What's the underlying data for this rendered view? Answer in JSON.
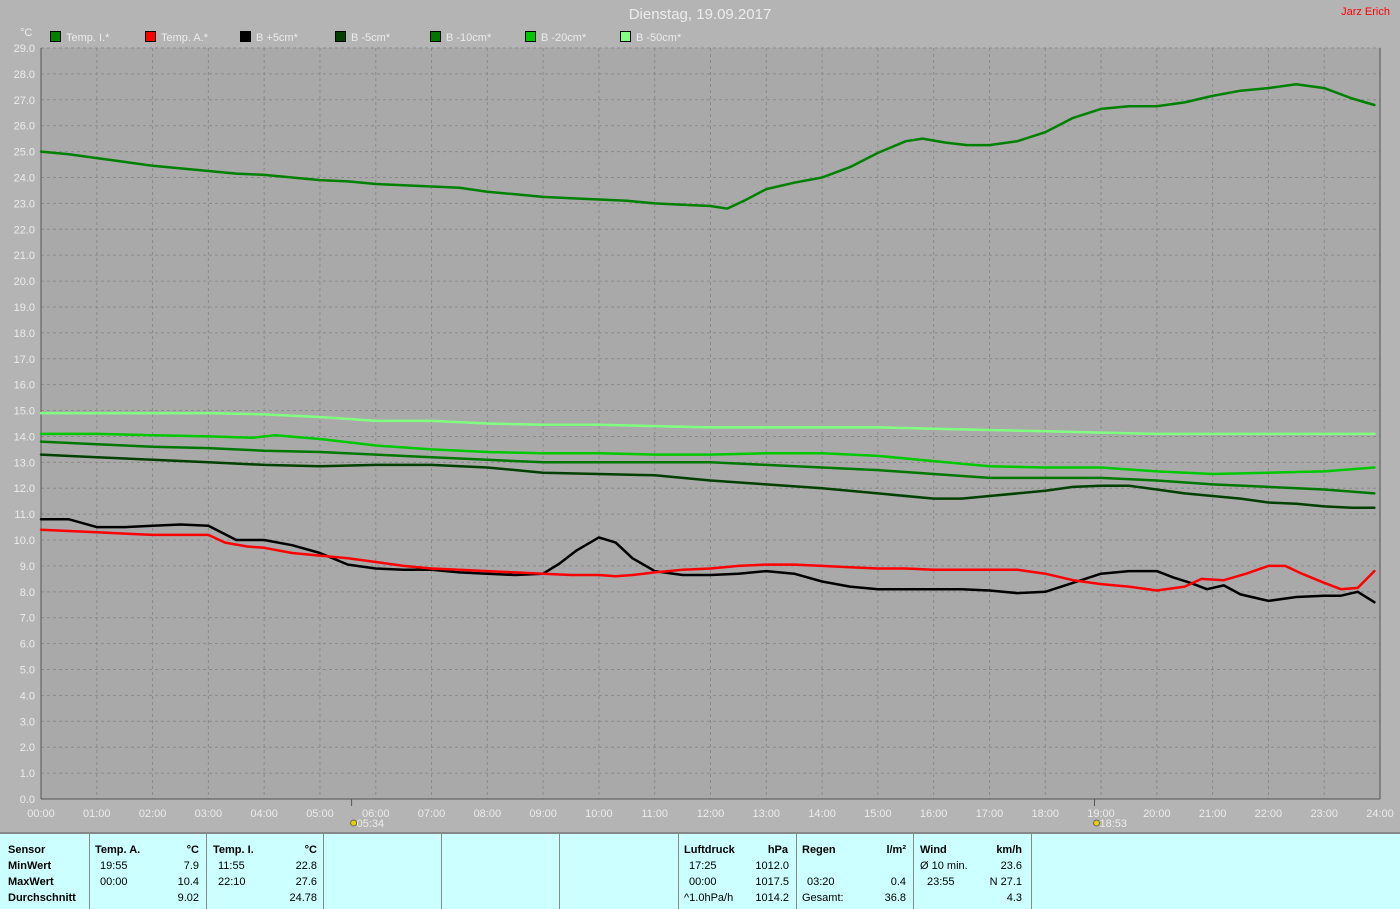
{
  "header": {
    "title": "Dienstag, 19.09.2017",
    "author": "Jarz Erich",
    "unit": "°C"
  },
  "legend": [
    {
      "label": "Temp. I.*",
      "color": "#008000"
    },
    {
      "label": "Temp. A.*",
      "color": "#ff0000"
    },
    {
      "label": "B +5cm*",
      "color": "#000000"
    },
    {
      "label": "B -5cm*",
      "color": "#004000"
    },
    {
      "label": "B -10cm*",
      "color": "#007800"
    },
    {
      "label": "B -20cm*",
      "color": "#00c800"
    },
    {
      "label": "B -50cm*",
      "color": "#80ff80"
    }
  ],
  "sun": {
    "sunrise": "05:34",
    "sunset": "18:53",
    "sunrise_hour": 5.567,
    "sunset_hour": 18.883
  },
  "chart_data": {
    "type": "line",
    "title": "Dienstag, 19.09.2017",
    "ylabel": "°C",
    "ylim": [
      0,
      29
    ],
    "xlim": [
      0,
      24
    ],
    "grid": true,
    "legend_position": "top",
    "y_ticks": [
      "0.0",
      "1.0",
      "2.0",
      "3.0",
      "4.0",
      "5.0",
      "6.0",
      "7.0",
      "8.0",
      "9.0",
      "10.0",
      "11.0",
      "12.0",
      "13.0",
      "14.0",
      "15.0",
      "16.0",
      "17.0",
      "18.0",
      "19.0",
      "20.0",
      "21.0",
      "22.0",
      "23.0",
      "24.0",
      "25.0",
      "26.0",
      "27.0",
      "28.0",
      "29.0"
    ],
    "x_ticks": [
      "00:00",
      "01:00",
      "02:00",
      "03:00",
      "04:00",
      "05:00",
      "06:00",
      "07:00",
      "08:00",
      "09:00",
      "10:00",
      "11:00",
      "12:00",
      "13:00",
      "14:00",
      "15:00",
      "16:00",
      "17:00",
      "18:00",
      "19:00",
      "20:00",
      "21:00",
      "22:00",
      "23:00",
      "24:00"
    ],
    "series": [
      {
        "name": "Temp. I.*",
        "color": "#008000",
        "x": [
          0,
          0.5,
          1,
          1.5,
          2,
          2.5,
          3,
          3.5,
          4,
          4.5,
          5,
          5.5,
          6,
          6.5,
          7,
          7.5,
          8,
          8.5,
          9,
          9.5,
          10,
          10.5,
          11,
          11.5,
          12,
          12.3,
          12.6,
          13,
          13.5,
          14,
          14.5,
          15,
          15.5,
          15.8,
          16.2,
          16.6,
          17,
          17.5,
          18,
          18.5,
          19,
          19.5,
          20,
          20.5,
          21,
          21.5,
          22,
          22.5,
          23,
          23.5,
          23.9
        ],
        "y": [
          25.0,
          24.9,
          24.75,
          24.6,
          24.45,
          24.35,
          24.25,
          24.15,
          24.1,
          24.0,
          23.9,
          23.85,
          23.75,
          23.7,
          23.65,
          23.6,
          23.45,
          23.35,
          23.25,
          23.2,
          23.15,
          23.1,
          23.0,
          22.95,
          22.9,
          22.8,
          23.1,
          23.55,
          23.8,
          24.0,
          24.4,
          24.95,
          25.4,
          25.5,
          25.35,
          25.25,
          25.25,
          25.4,
          25.75,
          26.3,
          26.65,
          26.75,
          26.75,
          26.9,
          27.15,
          27.35,
          27.45,
          27.6,
          27.45,
          27.05,
          26.8
        ]
      },
      {
        "name": "Temp. A.*",
        "color": "#ff0000",
        "x": [
          0,
          0.5,
          1,
          1.5,
          2,
          2.5,
          3,
          3.3,
          3.7,
          4,
          4.5,
          5,
          5.5,
          6,
          6.5,
          7,
          7.5,
          8,
          8.5,
          9,
          9.5,
          10,
          10.3,
          10.6,
          11,
          11.5,
          12,
          12.5,
          13,
          13.5,
          14,
          14.5,
          15,
          15.5,
          16,
          16.5,
          17,
          17.5,
          18,
          18.5,
          19,
          19.5,
          20,
          20.5,
          20.8,
          21.2,
          21.6,
          22,
          22.3,
          22.6,
          23,
          23.3,
          23.6,
          23.9
        ],
        "y": [
          10.4,
          10.35,
          10.3,
          10.25,
          10.2,
          10.2,
          10.2,
          9.9,
          9.75,
          9.7,
          9.5,
          9.4,
          9.3,
          9.15,
          9.0,
          8.9,
          8.85,
          8.8,
          8.75,
          8.7,
          8.65,
          8.65,
          8.6,
          8.65,
          8.75,
          8.85,
          8.9,
          9.0,
          9.05,
          9.05,
          9.0,
          8.95,
          8.9,
          8.9,
          8.85,
          8.85,
          8.85,
          8.85,
          8.7,
          8.45,
          8.3,
          8.2,
          8.05,
          8.2,
          8.5,
          8.45,
          8.7,
          9.0,
          9.0,
          8.7,
          8.35,
          8.1,
          8.15,
          8.8
        ]
      },
      {
        "name": "B +5cm*",
        "color": "#000000",
        "x": [
          0,
          0.5,
          1,
          1.5,
          2,
          2.5,
          3,
          3.5,
          4,
          4.5,
          5,
          5.5,
          6,
          6.5,
          7,
          7.5,
          8,
          8.5,
          9,
          9.3,
          9.6,
          10,
          10.3,
          10.6,
          11,
          11.5,
          12,
          12.5,
          13,
          13.5,
          14,
          14.5,
          15,
          15.5,
          16,
          16.5,
          17,
          17.5,
          18,
          18.5,
          19,
          19.5,
          20,
          20.3,
          20.6,
          20.9,
          21.2,
          21.5,
          22,
          22.5,
          23,
          23.3,
          23.6,
          23.9
        ],
        "y": [
          10.8,
          10.8,
          10.5,
          10.5,
          10.55,
          10.6,
          10.55,
          10.0,
          10.0,
          9.8,
          9.5,
          9.05,
          8.9,
          8.85,
          8.85,
          8.75,
          8.7,
          8.65,
          8.7,
          9.1,
          9.6,
          10.1,
          9.9,
          9.3,
          8.8,
          8.65,
          8.65,
          8.7,
          8.8,
          8.7,
          8.4,
          8.2,
          8.1,
          8.1,
          8.1,
          8.1,
          8.05,
          7.95,
          8.0,
          8.35,
          8.7,
          8.8,
          8.8,
          8.55,
          8.35,
          8.1,
          8.25,
          7.9,
          7.65,
          7.8,
          7.85,
          7.85,
          8.0,
          7.6
        ]
      },
      {
        "name": "B -5cm*",
        "color": "#004000",
        "x": [
          0,
          1,
          2,
          3,
          4,
          5,
          6,
          7,
          8,
          9,
          10,
          11,
          12,
          13,
          14,
          15,
          16,
          16.5,
          17,
          17.5,
          18,
          18.5,
          19,
          19.5,
          20,
          20.5,
          21,
          21.5,
          22,
          22.5,
          23,
          23.5,
          23.9
        ],
        "y": [
          13.3,
          13.2,
          13.1,
          13.0,
          12.9,
          12.85,
          12.9,
          12.9,
          12.8,
          12.6,
          12.55,
          12.5,
          12.3,
          12.15,
          12.0,
          11.8,
          11.6,
          11.6,
          11.7,
          11.8,
          11.9,
          12.05,
          12.1,
          12.1,
          11.95,
          11.8,
          11.7,
          11.6,
          11.45,
          11.4,
          11.3,
          11.25,
          11.25
        ]
      },
      {
        "name": "B -10cm*",
        "color": "#007800",
        "x": [
          0,
          1,
          2,
          3,
          4,
          5,
          6,
          7,
          8,
          9,
          10,
          11,
          12,
          13,
          14,
          15,
          16,
          17,
          18,
          19,
          20,
          21,
          22,
          23,
          23.9
        ],
        "y": [
          13.8,
          13.7,
          13.6,
          13.55,
          13.45,
          13.4,
          13.3,
          13.2,
          13.1,
          13.0,
          13.0,
          13.0,
          13.0,
          12.9,
          12.8,
          12.7,
          12.55,
          12.4,
          12.4,
          12.4,
          12.3,
          12.15,
          12.05,
          11.95,
          11.8
        ]
      },
      {
        "name": "B -20cm*",
        "color": "#00c800",
        "x": [
          0,
          1,
          2,
          3,
          3.8,
          4.2,
          5,
          6,
          7,
          8,
          9,
          10,
          11,
          12,
          13,
          14,
          15,
          16,
          17,
          18,
          19,
          20,
          21,
          22,
          23,
          23.9
        ],
        "y": [
          14.1,
          14.1,
          14.05,
          14.0,
          13.95,
          14.05,
          13.9,
          13.65,
          13.5,
          13.4,
          13.35,
          13.35,
          13.3,
          13.3,
          13.35,
          13.35,
          13.25,
          13.05,
          12.85,
          12.8,
          12.8,
          12.65,
          12.55,
          12.6,
          12.65,
          12.8
        ]
      },
      {
        "name": "B -50cm*",
        "color": "#80ff80",
        "x": [
          0,
          1,
          2,
          3,
          4,
          5,
          6,
          7,
          8,
          9,
          10,
          11,
          12,
          13,
          14,
          15,
          16,
          17,
          18,
          19,
          20,
          21,
          22,
          23,
          23.9
        ],
        "y": [
          14.9,
          14.9,
          14.9,
          14.9,
          14.85,
          14.75,
          14.6,
          14.6,
          14.5,
          14.45,
          14.45,
          14.4,
          14.35,
          14.35,
          14.35,
          14.35,
          14.3,
          14.25,
          14.2,
          14.15,
          14.1,
          14.1,
          14.1,
          14.1,
          14.1
        ]
      }
    ]
  },
  "table": {
    "sensor": {
      "header": "Sensor",
      "min": "MinWert",
      "max": "MaxWert",
      "avg": "Durchschnitt"
    },
    "temp_a": {
      "header": "Temp. A.",
      "unit": "°C",
      "min_time": "19:55",
      "min_val": "7.9",
      "max_time": "00:00",
      "max_val": "10.4",
      "avg": "9.02"
    },
    "temp_i": {
      "header": "Temp. I.",
      "unit": "°C",
      "min_time": "11:55",
      "min_val": "22.8",
      "max_time": "22:10",
      "max_val": "27.6",
      "avg": "24.78"
    },
    "pressure": {
      "header": "Luftdruck",
      "unit": "hPa",
      "min_time": "17:25",
      "min_val": "1012.0",
      "max_time": "00:00",
      "max_val": "1017.5",
      "trend": "^1.0hPa/h",
      "avg": "1014.2"
    },
    "rain": {
      "header": "Regen",
      "unit": "l/m²",
      "max_time": "03:20",
      "max_val": "0.4",
      "total_label": "Gesamt:",
      "total": "36.8"
    },
    "wind": {
      "header": "Wind",
      "unit": "km/h",
      "avg_label": "Ø 10 min.",
      "avg_val": "23.6",
      "max_time": "23:55",
      "max_val": "N 27.1",
      "day_avg": "4.3"
    }
  }
}
